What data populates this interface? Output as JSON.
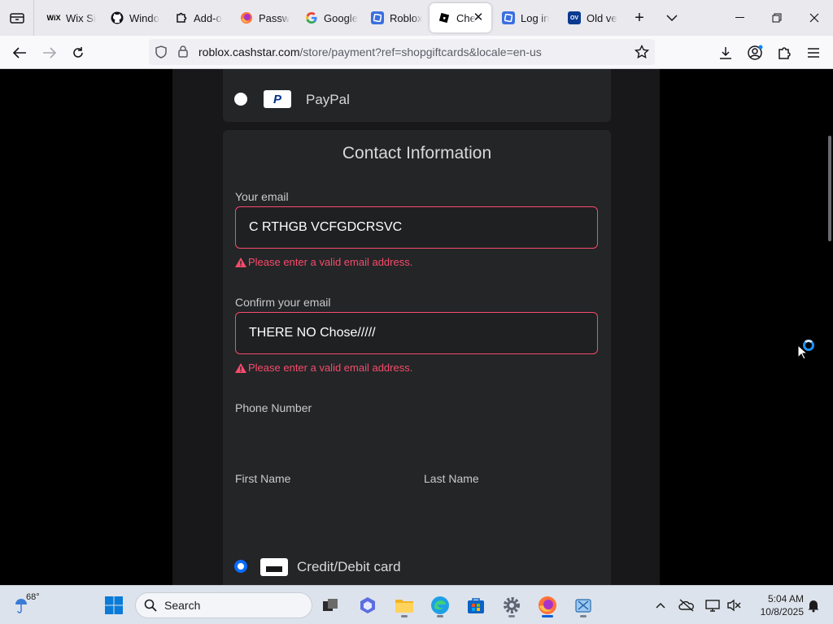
{
  "browser": {
    "tabs": [
      {
        "label": "Wix Si",
        "icon": "wix-icon",
        "fav_text": "WiX",
        "fav_color": "#000000"
      },
      {
        "label": "Windo",
        "icon": "github-icon",
        "fav_text": "",
        "fav_color": "#15141a"
      },
      {
        "label": "Add-o",
        "icon": "puzzle-icon",
        "fav_text": "",
        "fav_color": "#15141a"
      },
      {
        "label": "Passw",
        "icon": "firefox-icon",
        "fav_text": "",
        "fav_color": "#ff7139"
      },
      {
        "label": "Google",
        "icon": "google-icon",
        "fav_text": "G",
        "fav_color": "#4285f4"
      },
      {
        "label": "Roblox",
        "icon": "roblox-icon",
        "fav_text": "",
        "fav_color": "#3b6fe0"
      },
      {
        "label": "Che",
        "icon": "roblox-black-icon",
        "fav_text": "",
        "fav_color": "#000000",
        "active": true
      },
      {
        "label": "Log in",
        "icon": "roblox-icon",
        "fav_text": "",
        "fav_color": "#3b6fe0"
      },
      {
        "label": "Old ve",
        "icon": "ov-icon",
        "fav_text": "OV",
        "fav_color": "#0b3b8f"
      }
    ],
    "url_host": "roblox.cashstar.com",
    "url_path": "/store/payment?ref=shopgiftcards&locale=en-us"
  },
  "page": {
    "paypal_label": "PayPal",
    "section_title": "Contact Information",
    "email_label": "Your email",
    "email_value": "C RTHGB VCFGDCRSVC",
    "email_error": "Please enter a valid email address.",
    "confirm_label": "Confirm your email",
    "confirm_value": "THERE NO Chose/////",
    "confirm_error": "Please enter a valid email address.",
    "phone_label": "Phone Number",
    "first_name_label": "First Name",
    "last_name_label": "Last Name",
    "card_label": "Credit/Debit card",
    "error_color": "#f74b6b",
    "accent_color": "#0a6cff"
  },
  "taskbar": {
    "weather_temp": "68°",
    "search_placeholder": "Search",
    "time": "5:04 AM",
    "date": "10/8/2025"
  }
}
